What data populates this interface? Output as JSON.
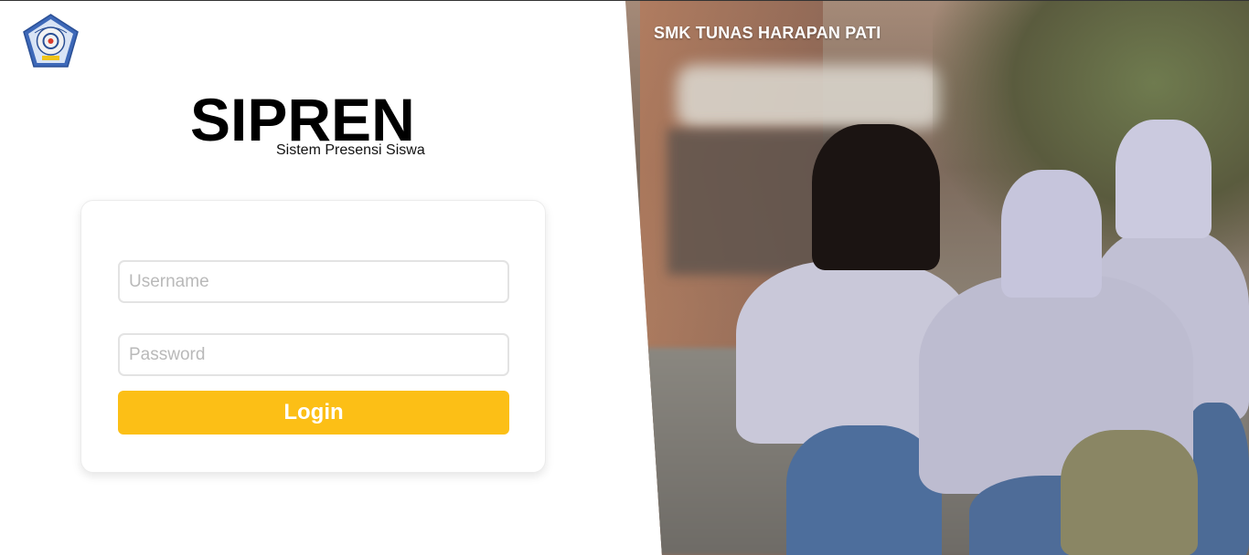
{
  "school": {
    "name": "SMK TUNAS HARAPAN PATI",
    "logo_icon": "school-emblem-icon"
  },
  "app": {
    "title": "SIPREN",
    "subtitle": "Sistem Presensi Siswa"
  },
  "login_form": {
    "username_placeholder": "Username",
    "password_placeholder": "Password",
    "login_label": "Login"
  },
  "colors": {
    "accent": "#fcbf16",
    "card_border": "#ececec"
  }
}
